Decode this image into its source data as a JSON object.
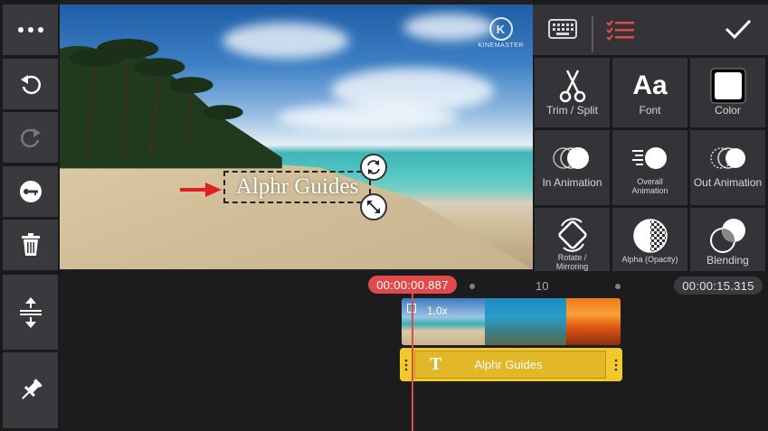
{
  "left_toolbar": {
    "items": [
      {
        "name": "more-button",
        "icon": "ellipsis-icon"
      },
      {
        "name": "undo-button",
        "icon": "undo-icon"
      },
      {
        "name": "redo-button",
        "icon": "redo-icon"
      },
      {
        "name": "key-button",
        "icon": "key-icon"
      },
      {
        "name": "delete-button",
        "icon": "trash-icon"
      },
      {
        "name": "expand-timeline-button",
        "icon": "expand-vertical-icon"
      },
      {
        "name": "pin-button",
        "icon": "pin-icon"
      }
    ]
  },
  "preview": {
    "watermark_letter": "K",
    "watermark_text": "KINEMASTER",
    "overlay_text": "Alphr Guides"
  },
  "right_panel": {
    "keyboard_icon": "keyboard-icon",
    "checklist_icon": "checklist-icon",
    "confirm_icon": "checkmark-icon",
    "font_glyph": "Aa",
    "tools": [
      {
        "label": "Trim / Split"
      },
      {
        "label": "Font"
      },
      {
        "label": "Color"
      },
      {
        "label": "In Animation"
      },
      {
        "label": "Overall Animation"
      },
      {
        "label": "Out Animation"
      },
      {
        "label": "Rotate / Mirroring"
      },
      {
        "label": "Alpha (Opacity)"
      },
      {
        "label": "Blending"
      }
    ]
  },
  "timeline": {
    "current_time": "00:00:00.887",
    "total_time": "00:00:15.315",
    "ruler_mark": "10",
    "video_clip_speed": "1.0x",
    "text_clip_label": "Alphr Guides",
    "text_clip_icon": "T"
  },
  "colors": {
    "accent_red": "#e04a4a",
    "clip_yellow": "#f2c92d",
    "panel_bg": "#333338"
  }
}
